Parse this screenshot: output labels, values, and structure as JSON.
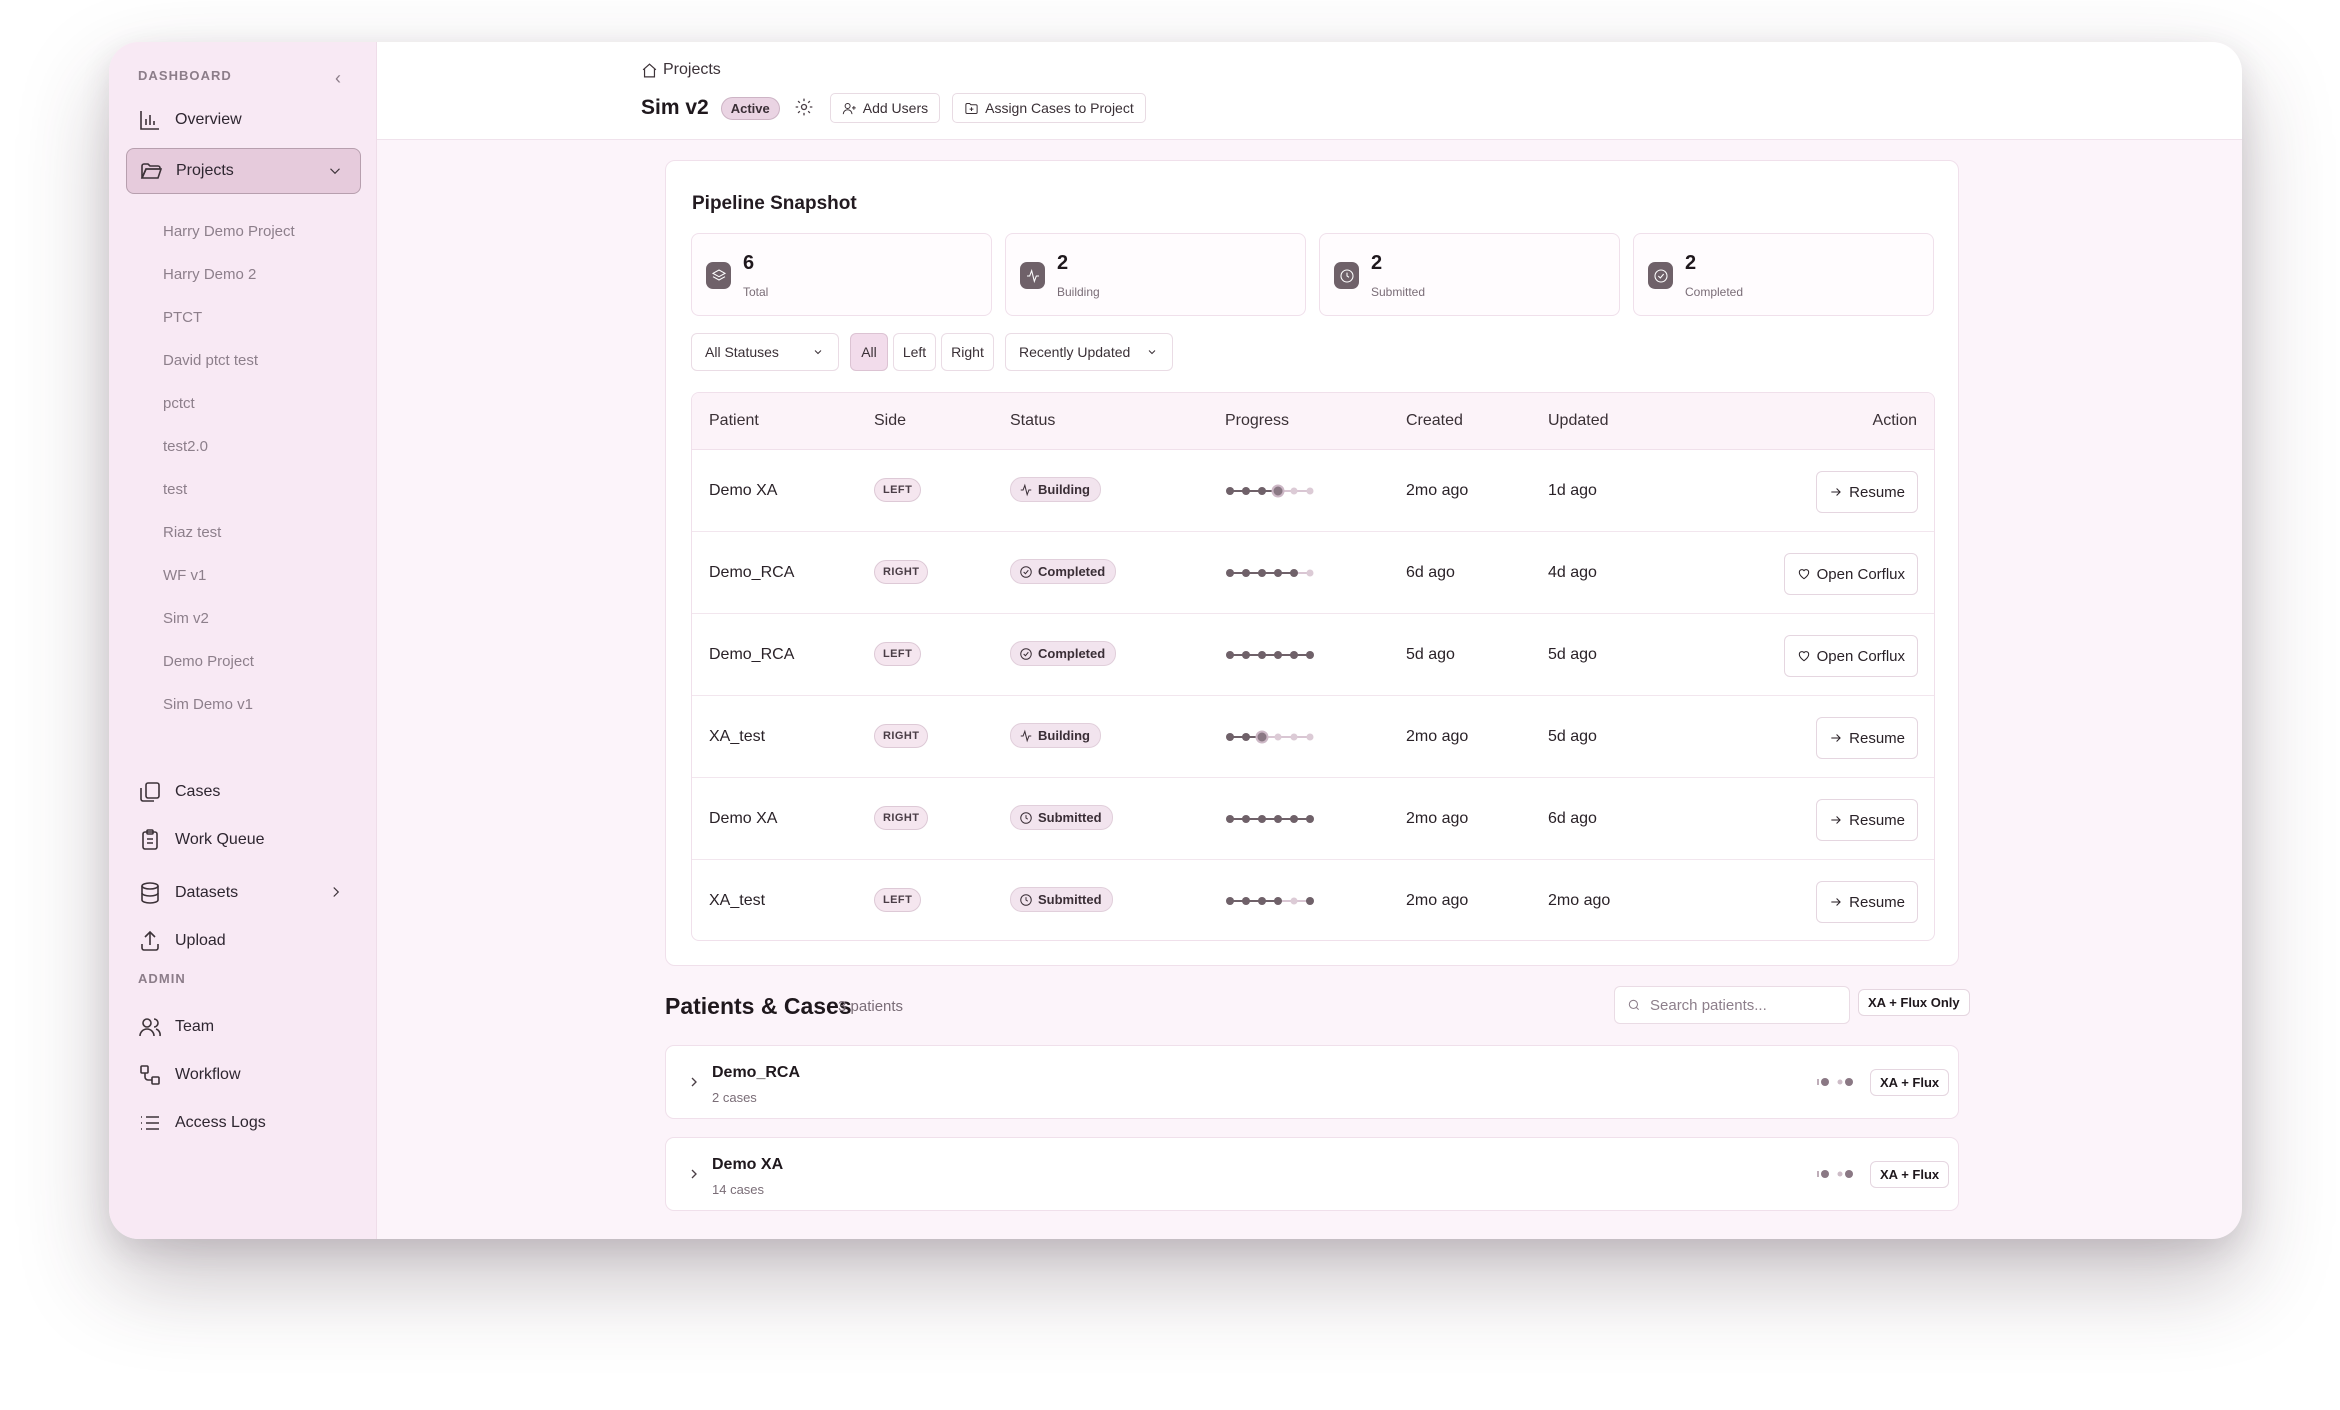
{
  "sidebar": {
    "dashboard_label": "DASHBOARD",
    "admin_label": "ADMIN",
    "nav": {
      "overview": "Overview",
      "projects": "Projects",
      "cases": "Cases",
      "work_queue": "Work Queue",
      "datasets": "Datasets",
      "upload": "Upload",
      "team": "Team",
      "workflow": "Workflow",
      "access_logs": "Access Logs"
    },
    "projects": [
      "Harry Demo Project",
      "Harry Demo 2",
      "PTCT",
      "David ptct test",
      "pctct",
      "test2.0",
      "test",
      "Riaz test",
      "WF v1",
      "Sim v2",
      "Demo Project",
      "Sim Demo v1"
    ]
  },
  "header": {
    "breadcrumb": "Projects",
    "title": "Sim v2",
    "status": "Active",
    "add_users": "Add Users",
    "assign_cases": "Assign Cases to Project"
  },
  "pipeline": {
    "title": "Pipeline Snapshot",
    "stats": [
      {
        "value": "6",
        "label": "Total",
        "icon": "layers-icon"
      },
      {
        "value": "2",
        "label": "Building",
        "icon": "activity-icon"
      },
      {
        "value": "2",
        "label": "Submitted",
        "icon": "clock-icon"
      },
      {
        "value": "2",
        "label": "Completed",
        "icon": "check-circle-icon"
      }
    ],
    "filters": {
      "status": "All Statuses",
      "side_all": "All",
      "side_left": "Left",
      "side_right": "Right",
      "sort": "Recently Updated"
    },
    "columns": {
      "patient": "Patient",
      "side": "Side",
      "status": "Status",
      "progress": "Progress",
      "created": "Created",
      "updated": "Updated",
      "action": "Action"
    },
    "rows": [
      {
        "patient": "Demo XA",
        "side": "LEFT",
        "status": "Building",
        "status_icon": "activity-icon",
        "progress_steps": [
          1,
          1,
          1,
          2,
          0,
          0
        ],
        "created": "2mo ago",
        "updated": "1d ago",
        "action": "Resume",
        "action_icon": "arrow-right-icon"
      },
      {
        "patient": "Demo_RCA",
        "side": "RIGHT",
        "status": "Completed",
        "status_icon": "check-circle-icon",
        "progress_steps": [
          1,
          1,
          1,
          1,
          1,
          0
        ],
        "created": "6d ago",
        "updated": "4d ago",
        "action": "Open Corflux",
        "action_icon": "heart-icon"
      },
      {
        "patient": "Demo_RCA",
        "side": "LEFT",
        "status": "Completed",
        "status_icon": "check-circle-icon",
        "progress_steps": [
          1,
          1,
          1,
          1,
          1,
          1
        ],
        "created": "5d ago",
        "updated": "5d ago",
        "action": "Open Corflux",
        "action_icon": "heart-icon"
      },
      {
        "patient": "XA_test",
        "side": "RIGHT",
        "status": "Building",
        "status_icon": "activity-icon",
        "progress_steps": [
          1,
          1,
          2,
          0,
          0,
          0
        ],
        "created": "2mo ago",
        "updated": "5d ago",
        "action": "Resume",
        "action_icon": "arrow-right-icon"
      },
      {
        "patient": "Demo XA",
        "side": "RIGHT",
        "status": "Submitted",
        "status_icon": "clock-icon",
        "progress_steps": [
          1,
          1,
          1,
          1,
          1,
          1
        ],
        "created": "2mo ago",
        "updated": "6d ago",
        "action": "Resume",
        "action_icon": "arrow-right-icon"
      },
      {
        "patient": "XA_test",
        "side": "LEFT",
        "status": "Submitted",
        "status_icon": "clock-icon",
        "progress_steps": [
          1,
          1,
          1,
          1,
          0,
          1
        ],
        "created": "2mo ago",
        "updated": "2mo ago",
        "action": "Resume",
        "action_icon": "arrow-right-icon"
      }
    ]
  },
  "patients": {
    "title": "Patients & Cases",
    "count": "3 patients",
    "search_placeholder": "Search patients...",
    "filter_tag": "XA + Flux Only",
    "items": [
      {
        "name": "Demo_RCA",
        "cases": "2 cases",
        "tag": "XA + Flux"
      },
      {
        "name": "Demo XA",
        "cases": "14 cases",
        "tag": "XA + Flux"
      }
    ]
  },
  "colors": {
    "accent": "#6f6169",
    "sidebar_bg": "#f8e9f4",
    "active_nav": "#e6cbdc",
    "badge": "#f2e4ee"
  }
}
